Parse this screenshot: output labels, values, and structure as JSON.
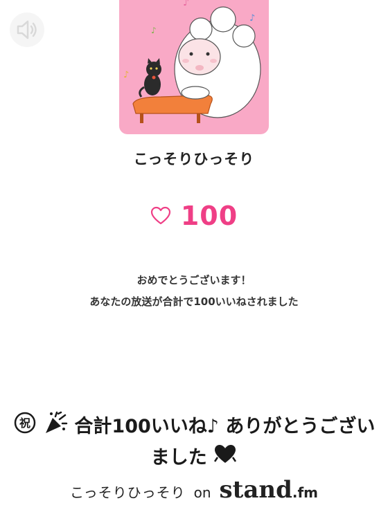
{
  "channel": {
    "name": "こっそりひっそり"
  },
  "likes": {
    "count": "100"
  },
  "message": {
    "line1": "おめでとうございます！",
    "line2": "あなたの放送が合計で100いいねされました"
  },
  "caption": {
    "text": "合計100いいね♪ ありがとうございました"
  },
  "footer": {
    "channel": "こっそりひっそり",
    "on": "on",
    "brand_main": "stand",
    "brand_suffix": ".fm"
  },
  "colors": {
    "accent": "#ef3f86",
    "artwork_bg": "#f9a9c6"
  },
  "icons": [
    "speaker-icon",
    "heart-outline-icon",
    "congratulations-icon",
    "party-popper-icon",
    "heart-ribbon-icon"
  ]
}
